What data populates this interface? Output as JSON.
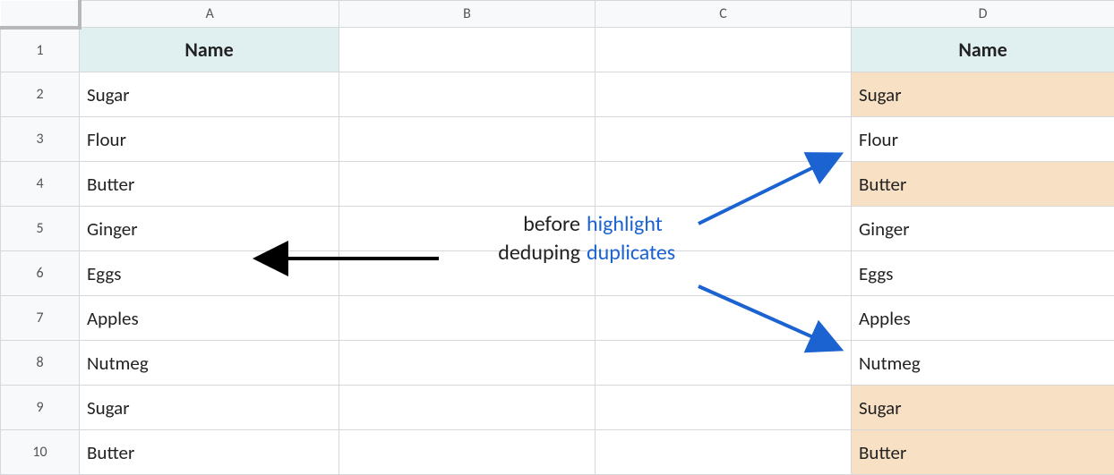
{
  "columns": [
    "A",
    "B",
    "C",
    "D"
  ],
  "rows": [
    "1",
    "2",
    "3",
    "4",
    "5",
    "6",
    "7",
    "8",
    "9",
    "10"
  ],
  "headers": {
    "a": "Name",
    "d": "Name"
  },
  "a": [
    "Sugar",
    "Flour",
    "Butter",
    "Ginger",
    "Eggs",
    "Apples",
    "Nutmeg",
    "Sugar",
    "Butter"
  ],
  "d": [
    "Sugar",
    "Flour",
    "Butter",
    "Ginger",
    "Eggs",
    "Apples",
    "Nutmeg",
    "Sugar",
    "Butter"
  ],
  "d_highlight": [
    true,
    false,
    true,
    false,
    false,
    false,
    false,
    true,
    true
  ],
  "annot": {
    "before_l1": "before",
    "before_l2": "deduping",
    "hl_l1": "highlight",
    "hl_l2": "duplicates"
  },
  "colors": {
    "header_bg": "#e0f0f0",
    "highlight_bg": "#f8e0c4",
    "arrow_black": "#000000",
    "arrow_blue": "#1a63d1"
  }
}
